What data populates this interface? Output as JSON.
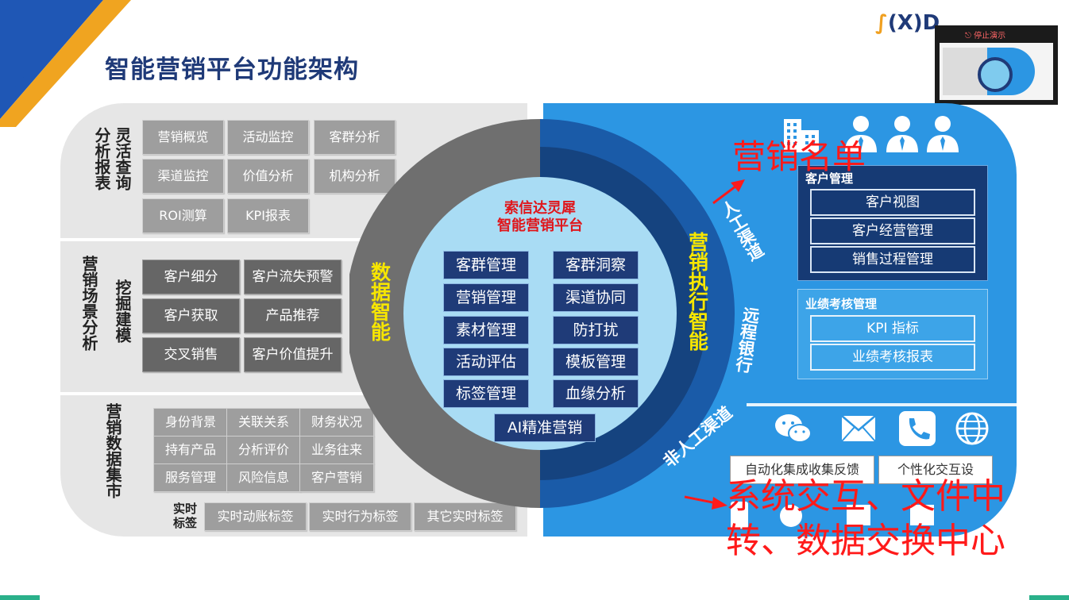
{
  "title": "智能营销平台功能架构",
  "logo": {
    "text": "(X)D"
  },
  "preview": {
    "stop_label": "停止演示"
  },
  "left_panel": {
    "section1": {
      "label_col1": "分析报表",
      "label_col2": "灵活查询",
      "buttons": [
        "营销概览",
        "活动监控",
        "客群分析",
        "渠道监控",
        "价值分析",
        "机构分析",
        "ROI测算",
        "KPI报表"
      ]
    },
    "section2": {
      "label_col1": "营销场景分析",
      "label_col2": "挖掘建模",
      "buttons": [
        "客户细分",
        "客户流失预警",
        "客户获取",
        "产品推荐",
        "交叉销售",
        "客户价值提升"
      ]
    },
    "section3": {
      "label": "营销数据集市",
      "buttons": [
        "身份背景",
        "关联关系",
        "财务状况",
        "持有产品",
        "分析评价",
        "业务往来",
        "服务管理",
        "风险信息",
        "客户营销"
      ],
      "realtime_label": "实时标签",
      "realtime_buttons": [
        "实时动账标签",
        "实时行为标签",
        "其它实时标签"
      ]
    }
  },
  "ring": {
    "left_text": "数据智能",
    "right_text": "营销执行智能",
    "channel_manual": "人工渠道",
    "channel_remote": "远程银行",
    "channel_non_manual": "非人工渠道"
  },
  "center": {
    "title_line1": "索信达灵犀",
    "title_line2": "智能营销平台",
    "buttons_left": [
      "客群管理",
      "营销管理",
      "素材管理",
      "活动评估",
      "标签管理"
    ],
    "buttons_right": [
      "客群洞察",
      "渠道协同",
      "防打扰",
      "模板管理",
      "血缘分析"
    ],
    "bottom_button": "AI精准营销"
  },
  "right_panel": {
    "customer_mgmt": {
      "title": "客户管理",
      "buttons": [
        "客户视图",
        "客户经营管理",
        "销售过程管理"
      ]
    },
    "kpi_mgmt": {
      "title": "业绩考核管理",
      "buttons": [
        "KPI 指标",
        "业绩考核报表"
      ]
    },
    "bottom_buttons": [
      "自动化集成收集反馈",
      "个性化交互设"
    ],
    "icons": [
      "building-icon",
      "person-icon",
      "person-icon",
      "person-icon",
      "wechat-icon",
      "mail-icon",
      "phone-icon",
      "globe-icon"
    ]
  },
  "annotations": {
    "marketing_list": "营销名单",
    "system_line1": "系统交互、文件中",
    "system_line2": "转、数据交换中心"
  },
  "colors": {
    "navy": "#1f3b78",
    "blue": "#2c96e3",
    "yellow": "#f7e600",
    "red": "#ff1a1a",
    "light_blue": "#a9dcf4"
  }
}
